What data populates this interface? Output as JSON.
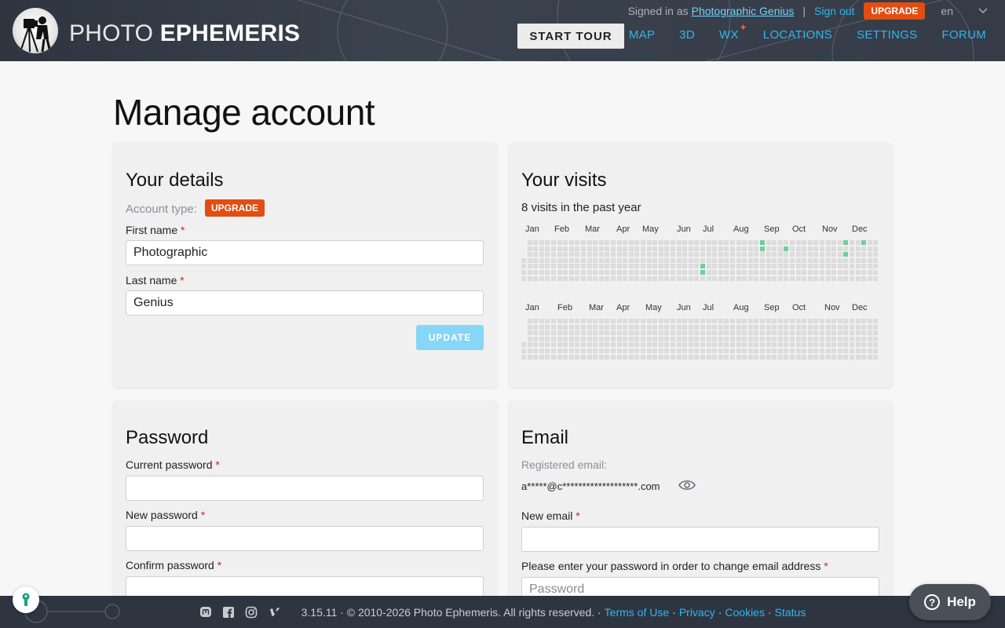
{
  "header": {
    "logo_light": "PHOTO",
    "logo_bold": "EPHEMERIS",
    "signed_in_prefix": "Signed in as",
    "user_name": "Photographic Genius",
    "sign_out": "Sign out",
    "upgrade": "UPGRADE",
    "language": "en",
    "start_tour": "START TOUR",
    "nav": [
      "MAP",
      "3D",
      "WX",
      "LOCATIONS",
      "SETTINGS",
      "FORUM"
    ]
  },
  "page": {
    "title": "Manage account"
  },
  "details": {
    "heading": "Your details",
    "account_type_label": "Account type:",
    "account_type_badge": "UPGRADE",
    "first_name_label": "First name",
    "first_name_value": "Photographic",
    "last_name_label": "Last name",
    "last_name_value": "Genius",
    "required_mark": "*",
    "update_button": "UPDATE"
  },
  "visits": {
    "heading": "Your visits",
    "summary": "8 visits in the past year",
    "months": [
      "Jan",
      "Feb",
      "Mar",
      "Apr",
      "May",
      "Jun",
      "Jul",
      "Aug",
      "Sep",
      "Oct",
      "Nov",
      "Dec"
    ],
    "visit_color": "#6fcf97",
    "empty_color": "#dcdcdc"
  },
  "password": {
    "heading": "Password",
    "current_label": "Current password",
    "new_label": "New password",
    "confirm_label": "Confirm password"
  },
  "email": {
    "heading": "Email",
    "registered_label": "Registered email:",
    "registered_value": "a*****@c*******************.com",
    "new_email_label": "New email",
    "password_prompt_label": "Please enter your password in order to change email address",
    "password_placeholder": "Password"
  },
  "footer": {
    "version_text": "3.15.11 · © 2010-2026 Photo Ephemeris. All rights reserved. ·",
    "links": [
      "Terms of Use",
      "Privacy",
      "Cookies",
      "Status"
    ]
  },
  "help": {
    "label": "Help"
  },
  "colors": {
    "accent": "#2fb6ef",
    "upgrade": "#e24d12",
    "header_bg": "#2e3540"
  }
}
